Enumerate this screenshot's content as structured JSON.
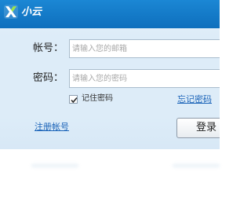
{
  "app": {
    "title": "小云"
  },
  "form": {
    "account_label": "帐号：",
    "account_placeholder": "请输入您的邮箱",
    "account_value": "",
    "password_label": "密码：",
    "password_placeholder": "请输入您的密码",
    "password_value": "",
    "remember_label": "记住密码",
    "remember_checked": true,
    "forgot_link": "忘记密码",
    "register_link": "注册帐号",
    "login_button": "登录"
  },
  "colors": {
    "titlebar": "#1680cf",
    "window_bg": "#ddecf8",
    "link": "#1a63b8"
  },
  "icons": {
    "logo": "x-logo-icon",
    "check": "check-icon"
  }
}
